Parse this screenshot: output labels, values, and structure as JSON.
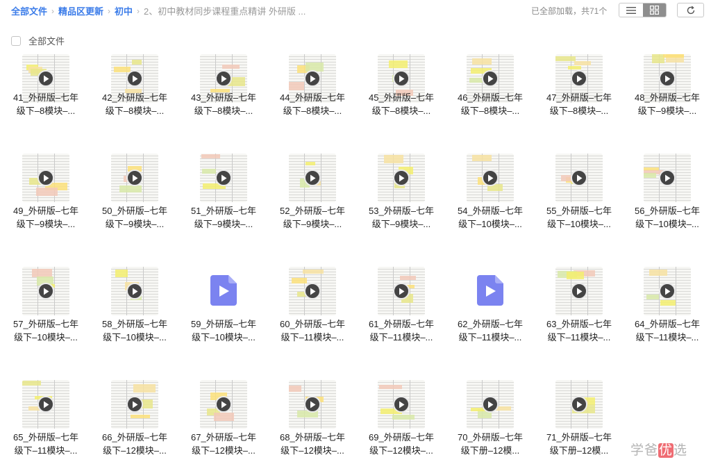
{
  "breadcrumb": {
    "items": [
      "全部文件",
      "精品区更新",
      "初中"
    ],
    "separator": "›",
    "current": "2、初中教材同步课程重点精讲 外研版 ..."
  },
  "toolbar": {
    "status": "已全部加载，共71个",
    "list_view_icon": "list-icon",
    "grid_view_icon": "grid-icon",
    "active_view": "grid",
    "refresh_icon": "refresh-icon"
  },
  "select_all": {
    "label": "全部文件",
    "checked": false
  },
  "colors": {
    "accent": "#3b7ce9",
    "video_icon": "#7b83f0",
    "watermark_accent": "#ef6c73"
  },
  "files": [
    {
      "line1": "41_外研版–七年",
      "line2": "级下–8模块–...",
      "type": "video-thumb"
    },
    {
      "line1": "42_外研版–七年",
      "line2": "级下–8模块–...",
      "type": "video-thumb"
    },
    {
      "line1": "43_外研版–七年",
      "line2": "级下–8模块–...",
      "type": "video-thumb"
    },
    {
      "line1": "44_外研版–七年",
      "line2": "级下–8模块–...",
      "type": "video-thumb"
    },
    {
      "line1": "45_外研版–七年",
      "line2": "级下–8模块–...",
      "type": "video-thumb"
    },
    {
      "line1": "46_外研版–七年",
      "line2": "级下–8模块–...",
      "type": "video-thumb"
    },
    {
      "line1": "47_外研版–七年",
      "line2": "级下–8模块–...",
      "type": "video-thumb"
    },
    {
      "line1": "48_外研版–七年",
      "line2": "级下–9模块–...",
      "type": "video-thumb"
    },
    {
      "line1": "49_外研版–七年",
      "line2": "级下–9模块–...",
      "type": "video-thumb"
    },
    {
      "line1": "50_外研版–七年",
      "line2": "级下–9模块–...",
      "type": "video-thumb"
    },
    {
      "line1": "51_外研版–七年",
      "line2": "级下–9模块–...",
      "type": "video-thumb"
    },
    {
      "line1": "52_外研版–七年",
      "line2": "级下–9模块–...",
      "type": "video-thumb"
    },
    {
      "line1": "53_外研版–七年",
      "line2": "级下–9模块–...",
      "type": "video-thumb"
    },
    {
      "line1": "54_外研版–七年",
      "line2": "级下–10模块–...",
      "type": "video-thumb"
    },
    {
      "line1": "55_外研版–七年",
      "line2": "级下–10模块–...",
      "type": "video-thumb"
    },
    {
      "line1": "56_外研版–七年",
      "line2": "级下–10模块–...",
      "type": "video-thumb"
    },
    {
      "line1": "57_外研版–七年",
      "line2": "级下–10模块–...",
      "type": "video-thumb"
    },
    {
      "line1": "58_外研版–七年",
      "line2": "级下–10模块–...",
      "type": "video-thumb"
    },
    {
      "line1": "59_外研版–七年",
      "line2": "级下–10模块–...",
      "type": "video-icon"
    },
    {
      "line1": "60_外研版–七年",
      "line2": "级下–11模块–...",
      "type": "video-thumb"
    },
    {
      "line1": "61_外研版–七年",
      "line2": "级下–11模块–...",
      "type": "video-thumb"
    },
    {
      "line1": "62_外研版–七年",
      "line2": "级下–11模块–...",
      "type": "video-icon"
    },
    {
      "line1": "63_外研版–七年",
      "line2": "级下–11模块–...",
      "type": "video-thumb"
    },
    {
      "line1": "64_外研版–七年",
      "line2": "级下–11模块–...",
      "type": "video-thumb"
    },
    {
      "line1": "65_外研版–七年",
      "line2": "级下–11模块–...",
      "type": "video-thumb"
    },
    {
      "line1": "66_外研版–七年",
      "line2": "级下–12模块–...",
      "type": "video-thumb"
    },
    {
      "line1": "67_外研版–七年",
      "line2": "级下–12模块–...",
      "type": "video-thumb"
    },
    {
      "line1": "68_外研版–七年",
      "line2": "级下–12模块–...",
      "type": "video-thumb"
    },
    {
      "line1": "69_外研版–七年",
      "line2": "级下–12模块–...",
      "type": "video-thumb"
    },
    {
      "line1": "70_外研版–七年",
      "line2": "级下册–12模...",
      "type": "video-thumb"
    },
    {
      "line1": "71_外研版–七年",
      "line2": "级下册–12模...",
      "type": "video-thumb"
    }
  ],
  "watermark": {
    "text_before": "学爸",
    "text_accent": "优",
    "text_after": "选"
  }
}
